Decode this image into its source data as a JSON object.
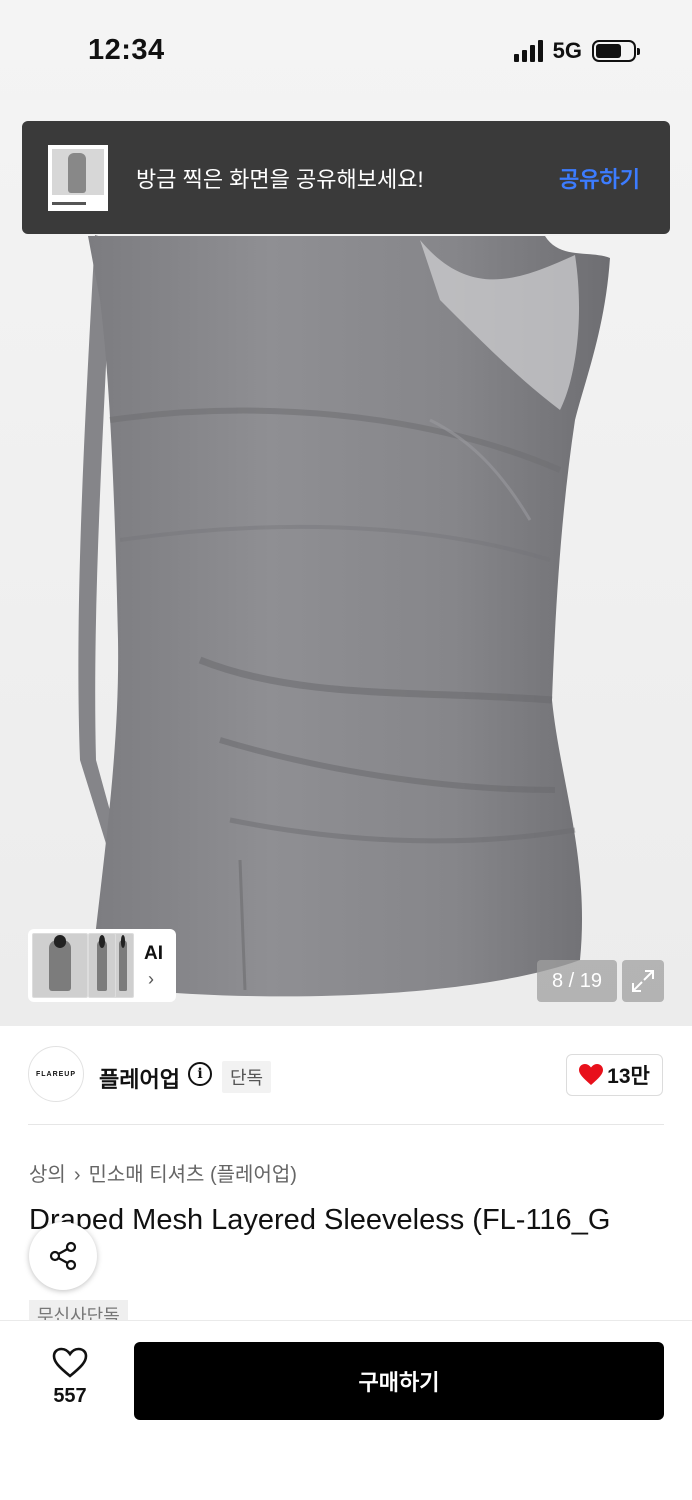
{
  "status_bar": {
    "time": "12:34",
    "network": "5G"
  },
  "toast": {
    "message": "방금 찍은 화면을 공유해보세요!",
    "action_label": "공유하기"
  },
  "gallery": {
    "ai_label": "AI",
    "ai_chevron": "›",
    "counter": "8 / 19"
  },
  "brand": {
    "logo_text": "FLAREUP",
    "name": "플레어업",
    "info": "i",
    "badge": "단독",
    "likes": "13만"
  },
  "breadcrumb": {
    "category": "상의",
    "separator": "›",
    "subcategory": "민소매 티셔츠 (플레어업)"
  },
  "product": {
    "title": "Draped Mesh Layered Sleeveless (FL-116_G",
    "tag": "무신사단독"
  },
  "bottom_bar": {
    "like_count": "557",
    "buy_label": "구매하기"
  },
  "colors": {
    "accent_blue": "#3c7cff",
    "heart_red": "#e8101b",
    "buy_button": "#000000",
    "toast_bg": "#3a3a3a"
  },
  "icons": [
    "signal-icon",
    "battery-icon",
    "expand-icon",
    "info-icon",
    "heart-icon",
    "share-icon",
    "heart-outline-icon"
  ]
}
